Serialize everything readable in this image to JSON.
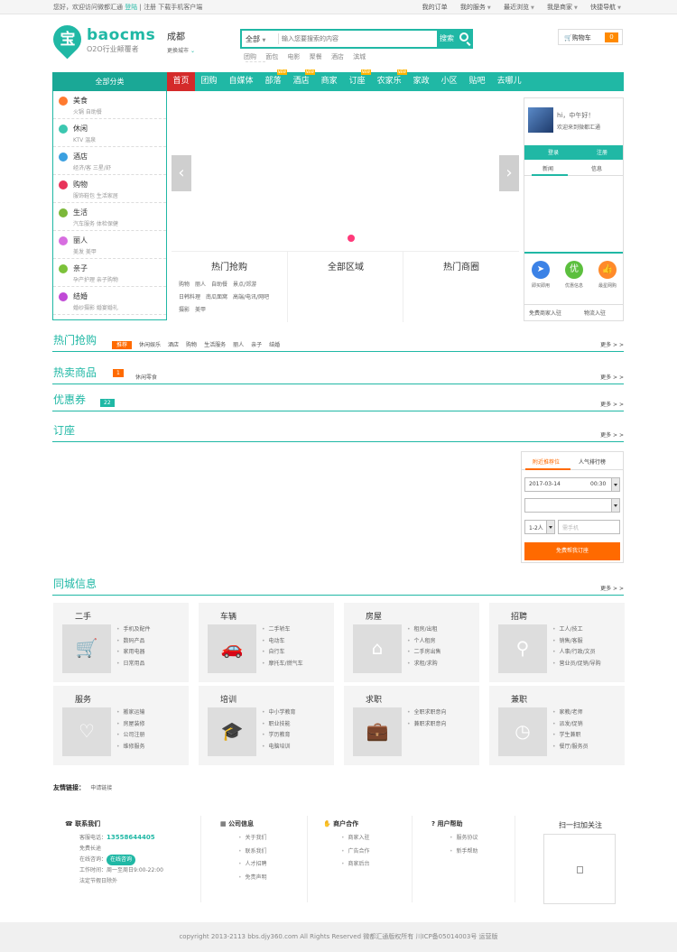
{
  "topbar": {
    "greeting": "您好，欢迎访问微都汇通",
    "login": "登陆",
    "divider": "|",
    "register": "注册",
    "app": "下载手机客户端",
    "right": [
      "我的订单",
      "我的服务",
      "最近浏览",
      "我是商家",
      "快捷导航"
    ]
  },
  "logo": {
    "mark": "宝",
    "name": "baocms",
    "slogan": "O2O行业颠覆者"
  },
  "city": {
    "name": "成都",
    "switch": "更换城市"
  },
  "search": {
    "category": "全部",
    "placeholder": "输入您要搜索的内容",
    "button": "搜索"
  },
  "hotwords": [
    "团购",
    "面包",
    "电影",
    "聚餐",
    "酒店",
    "滨城"
  ],
  "cart": {
    "label": "购物车",
    "count": "0"
  },
  "nav": {
    "all_categories": "全部分类",
    "items": [
      {
        "label": "首页",
        "new": ""
      },
      {
        "label": "团购",
        "new": ""
      },
      {
        "label": "自媒体",
        "new": ""
      },
      {
        "label": "部落",
        "new": "NEW"
      },
      {
        "label": "酒店",
        "new": "NEW"
      },
      {
        "label": "商家",
        "new": ""
      },
      {
        "label": "订座",
        "new": "NEW"
      },
      {
        "label": "农家乐",
        "new": "NEW"
      },
      {
        "label": "家政",
        "new": ""
      },
      {
        "label": "小区",
        "new": ""
      },
      {
        "label": "贴吧",
        "new": ""
      },
      {
        "label": "去哪儿",
        "new": ""
      }
    ]
  },
  "categories": [
    {
      "title": "美食",
      "sub": "火锅  自助餐",
      "color": "#ff7a2f"
    },
    {
      "title": "休闲",
      "sub": "KTV  温泉",
      "color": "#3cc7b0"
    },
    {
      "title": "酒店",
      "sub": "经济/客  三星/舒",
      "color": "#3ba0e0"
    },
    {
      "title": "购物",
      "sub": "服饰鞋包  生活家居",
      "color": "#e8335a"
    },
    {
      "title": "生活",
      "sub": "汽车服务  体检保健",
      "color": "#7cb83a"
    },
    {
      "title": "丽人",
      "sub": "美发  美甲",
      "color": "#d76ee0"
    },
    {
      "title": "亲子",
      "sub": "孕产护理  亲子购物",
      "color": "#7cc23a"
    },
    {
      "title": "结婚",
      "sub": "婚纱摄影  婚宴婚礼",
      "color": "#c04ad6"
    }
  ],
  "banner": {
    "prev": "‹",
    "next": "›"
  },
  "hot_columns": [
    {
      "title": "热门抢购",
      "links": [
        "购物",
        "丽人",
        "自助餐",
        "景点/郊游",
        "日韩料理",
        "南瓜面窝",
        "高端/电讯/网吧",
        "摄影",
        "美甲"
      ]
    },
    {
      "title": "全部区域",
      "links": []
    },
    {
      "title": "热门商圈",
      "links": []
    }
  ],
  "user": {
    "hi": "hi，中午好！",
    "welcome": "欢迎来到微都汇通",
    "login": "登录",
    "register": "注册",
    "tab_news": "新闻",
    "tab_info": "信息",
    "shortcuts": [
      {
        "glyph": "➤",
        "label": "即买即用",
        "color": "#3b82e6"
      },
      {
        "glyph": "优",
        "label": "优惠信息",
        "color": "#5cbf3e"
      },
      {
        "glyph": "👍",
        "label": "最星网购",
        "color": "#ff8a2a"
      }
    ],
    "footer_left": "免费商家入驻",
    "footer_right": "物流入驻"
  },
  "sections": {
    "hot_deal": {
      "title": "热门抢购",
      "more": "更多 > >",
      "tags": [
        "推荐",
        "休闲娱乐",
        "酒店",
        "购物",
        "生活服务",
        "丽人",
        "亲子",
        "结婚"
      ]
    },
    "hot_goods": {
      "title": "热卖商品",
      "more": "更多 > >",
      "badge": "1",
      "tag": "休闲零食"
    },
    "coupon": {
      "title": "优惠券",
      "more": "更多 > >",
      "badge": "22"
    },
    "booking": {
      "title": "订座",
      "more": "更多 > >"
    },
    "local": {
      "title": "同城信息",
      "more": "更多 > >"
    }
  },
  "booking": {
    "tab1": "附近推荐位",
    "tab2": "人气排行榜",
    "date": "2017-03-14",
    "time": "00:30",
    "persons": "1-2人",
    "phone_placeholder": "需手机",
    "button": "免费帮我订座"
  },
  "local_cards": [
    {
      "title": "二手",
      "icon": "cart-icon",
      "links": [
        "手机及配件",
        "数码产品",
        "家用电器",
        "日常用品"
      ]
    },
    {
      "title": "车辆",
      "icon": "car-icon",
      "links": [
        "二手轿车",
        "电动车",
        "自行车",
        "摩托车/燃气车"
      ]
    },
    {
      "title": "房屋",
      "icon": "house-icon",
      "links": [
        "租房/出租",
        "个人租房",
        "二手房出售",
        "求租/求购"
      ]
    },
    {
      "title": "招聘",
      "icon": "person-search-icon",
      "links": [
        "工人/技工",
        "销售/客服",
        "人事/行政/文员",
        "营业员/促销/导购"
      ]
    },
    {
      "title": "服务",
      "icon": "heart-icon",
      "links": [
        "搬家运输",
        "房屋装修",
        "公司注册",
        "维修服务"
      ]
    },
    {
      "title": "培训",
      "icon": "graduation-icon",
      "links": [
        "中小学教育",
        "职业技能",
        "学历教育",
        "电脑培训"
      ]
    },
    {
      "title": "求职",
      "icon": "briefcase-icon",
      "links": [
        "全职求职意向",
        "兼职求职意向"
      ]
    },
    {
      "title": "兼职",
      "icon": "clock-icon",
      "links": [
        "家教/老师",
        "派发/促销",
        "学生兼职",
        "餐厅/服务员"
      ]
    }
  ],
  "friend_links": {
    "label": "友情链接：",
    "value": "申请链接"
  },
  "footer": {
    "contact": {
      "title": "联系我们",
      "phone_label": "客服电话：",
      "phone": "13558644405",
      "note": "免费长途",
      "online_label": "在线咨询：",
      "online": "在线咨询",
      "hours_label": "工作时间：",
      "hours": "周一至周日9:00-22:00",
      "holiday": "法定节假日除外"
    },
    "columns": [
      {
        "title": "公司信息",
        "links": [
          "关于我们",
          "联系我们",
          "人才招聘",
          "免责声明"
        ]
      },
      {
        "title": "商户合作",
        "links": [
          "商家入驻",
          "广告合作",
          "商家后台"
        ]
      },
      {
        "title": "用户帮助",
        "links": [
          "服务协议",
          "新手帮助"
        ]
      }
    ],
    "qr_title": "扫一扫加关注"
  },
  "copyright": "copyright 2013-2113 bbs.djy360.com All Rights Reserved 微都汇通版权所有  川ICP备05014003号 运营版"
}
